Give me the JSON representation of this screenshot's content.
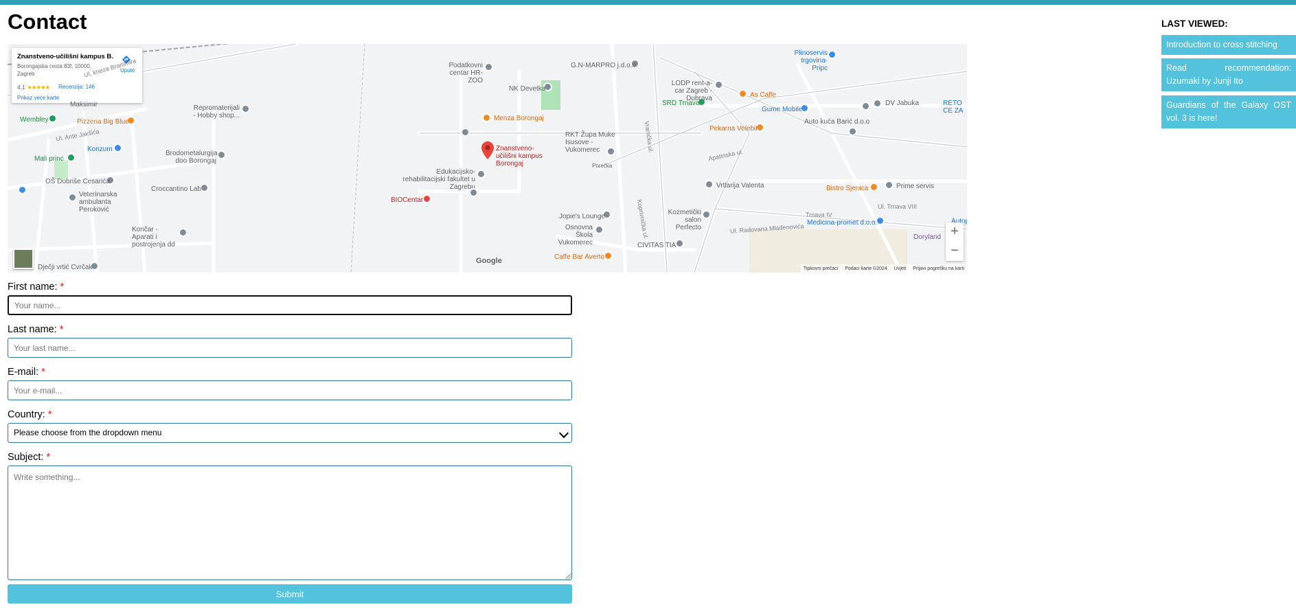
{
  "page": {
    "title": "Contact"
  },
  "map": {
    "place_card": {
      "title": "Znanstveno-učilišni kampus B...",
      "address": "Borongajska cesta 83f, 10000, Zagreb",
      "rating": "4,1",
      "stars": "★★★★★",
      "reviews": "Recenzija: 146",
      "larger_map": "Prikaz veće karte",
      "directions": "Upute"
    },
    "main_marker_label": "Znanstveno-učilišni kampus Borongaj",
    "labels": {
      "podatkovni": "Podatkovni centar HR-ZOO",
      "gnmarpro": "G.N-MARPRO j.d.o.o.",
      "nkdevetka": "NK Devetka",
      "menza": "Menza Borongaj",
      "rkt": "RKT Župa Muke Isusove - Vukomerec",
      "edukacijsko": "Edukacijsko-rehabilitacijski fakultet u Zagrebu",
      "biocentar": "BIOCentar",
      "jopies": "Jopie's Lounge",
      "osnovna": "Osnovna Škola Vukomerec",
      "caffebar": "Caffe Bar Averto",
      "civitas": "CIVITAS TIA",
      "kozmeticki": "Kozmetički salon Perfecto",
      "vrtlarija": "Vrtlarija Valenta",
      "pekarna": "Pekarna Velebit",
      "srd": "SRD Trnava",
      "lodp": "LODP rent-a-car Zagreb - Dubrava",
      "ascaffe": "As Caffe",
      "gume": "Gume Mobile",
      "plinoservis": "Plinoservis trgovina-Pripc",
      "dvjabuka": "DV Jabuka",
      "autokuca": "Auto kuća Barić d.o.o",
      "bistro": "Bistro Sjenica",
      "prime": "Prime servis",
      "medicina": "Medicina-promet d.o.o.",
      "doryland": "Doryland",
      "repromaterijali": "Repromaterijali - Hobby shop...",
      "pizzeria": "Pizzeria Big Blue",
      "konzum": "Konzum",
      "brodometal": "Brodometalurgija doo Borongaj",
      "maliprinc": "Mali princ",
      "osdobrise": "OŠ Dobriše Cesarića",
      "veterinarska": "Veterinarska ambulanta Peroković",
      "croccantino": "Croccantino Lab",
      "koncar": "Končar - Aparati i postrojenja dd",
      "djecji": "Dječji vrtić Cvrčak",
      "wembley": "Wembley",
      "maksimir": "Maksimir",
      "porecka": "Porečka",
      "reto": "RETO CE ZA",
      "autop": "Autop",
      "ul_kneza": "Ul. kneza Branimira",
      "ul_ante": "Ul. Ante Jakšića",
      "ul_apatinska": "Apatinska ul.",
      "ul_trnava8": "Ul. Trnava VIII",
      "ul_trnava4": "Trnava IV",
      "ul_radovana": "Ul. Radovana Mlađenovića",
      "ul_koprivnicka": "Koprivnička ul.",
      "ul_vranicka": "Vranička ul."
    },
    "zoom_in": "+",
    "zoom_out": "−",
    "google": "Google",
    "footer": [
      "Tipkovni prečaci",
      "Podaci karte ©2024",
      "Uvjeti",
      "Prijavi pogrešku na karti"
    ]
  },
  "form": {
    "first_name": {
      "label": "First name:",
      "required": "*",
      "placeholder": "Your name..."
    },
    "last_name": {
      "label": "Last name:",
      "required": "*",
      "placeholder": "Your last name..."
    },
    "email": {
      "label": "E-mail:",
      "required": "*",
      "placeholder": "Your e-mail..."
    },
    "country": {
      "label": "Country:",
      "required": "*",
      "selected": "Please choose from the dropdown menu"
    },
    "subject": {
      "label": "Subject:",
      "required": "*",
      "placeholder": "Write something..."
    },
    "submit": "Submit"
  },
  "sidebar": {
    "title": "LAST VIEWED:",
    "items": [
      {
        "label": "Introduction to cross stitching"
      },
      {
        "label": "Read recommendation: Uzumaki by Junji Ito"
      },
      {
        "label": "Guardians of the Galaxy OST vol. 3 is here!"
      }
    ]
  },
  "colors": {
    "accent": "#52c2dd",
    "topbar": "#2e9fb6",
    "required": "#e02020"
  }
}
